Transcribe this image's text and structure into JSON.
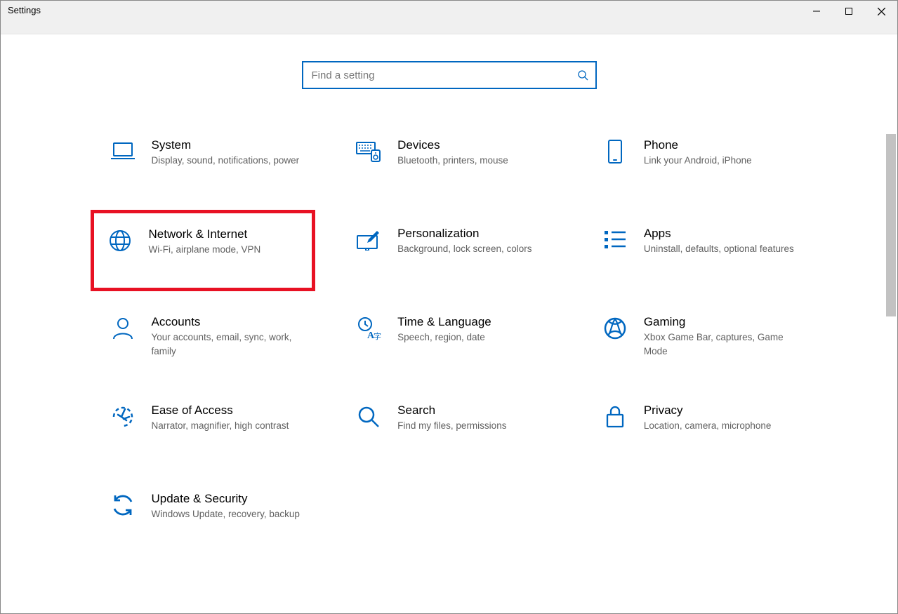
{
  "window": {
    "title": "Settings"
  },
  "search": {
    "placeholder": "Find a setting"
  },
  "categories": [
    {
      "key": "system",
      "title": "System",
      "desc": "Display, sound, notifications, power"
    },
    {
      "key": "devices",
      "title": "Devices",
      "desc": "Bluetooth, printers, mouse"
    },
    {
      "key": "phone",
      "title": "Phone",
      "desc": "Link your Android, iPhone"
    },
    {
      "key": "network",
      "title": "Network & Internet",
      "desc": "Wi-Fi, airplane mode, VPN",
      "highlight": true
    },
    {
      "key": "personalization",
      "title": "Personalization",
      "desc": "Background, lock screen, colors"
    },
    {
      "key": "apps",
      "title": "Apps",
      "desc": "Uninstall, defaults, optional features"
    },
    {
      "key": "accounts",
      "title": "Accounts",
      "desc": "Your accounts, email, sync, work, family"
    },
    {
      "key": "time",
      "title": "Time & Language",
      "desc": "Speech, region, date"
    },
    {
      "key": "gaming",
      "title": "Gaming",
      "desc": "Xbox Game Bar, captures, Game Mode"
    },
    {
      "key": "ease",
      "title": "Ease of Access",
      "desc": "Narrator, magnifier, high contrast"
    },
    {
      "key": "search",
      "title": "Search",
      "desc": "Find my files, permissions"
    },
    {
      "key": "privacy",
      "title": "Privacy",
      "desc": "Location, camera, microphone"
    },
    {
      "key": "update",
      "title": "Update & Security",
      "desc": "Windows Update, recovery, backup"
    }
  ]
}
